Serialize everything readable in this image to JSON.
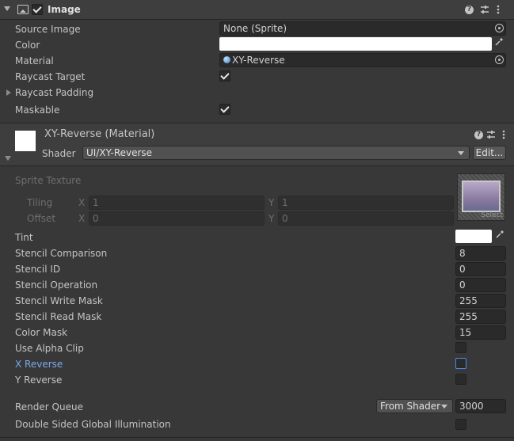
{
  "component": {
    "title": "Image",
    "enabled": true
  },
  "image_props": {
    "source_image_label": "Source Image",
    "source_image_value": "None (Sprite)",
    "color_label": "Color",
    "material_label": "Material",
    "material_value": "XY-Reverse",
    "raycast_target_label": "Raycast Target",
    "raycast_target_checked": true,
    "raycast_padding_label": "Raycast Padding",
    "maskable_label": "Maskable",
    "maskable_checked": true
  },
  "material": {
    "title": "XY-Reverse (Material)",
    "shader_label": "Shader",
    "shader_value": "UI/XY-Reverse",
    "edit_button": "Edit...",
    "sprite_texture_label": "Sprite Texture",
    "tiling_label": "Tiling",
    "offset_label": "Offset",
    "x_label": "X",
    "y_label": "Y",
    "tiling_x": "1",
    "tiling_y": "1",
    "offset_x": "0",
    "offset_y": "0",
    "select_label": "Select",
    "tint_label": "Tint",
    "stencil_comparison_label": "Stencil Comparison",
    "stencil_comparison_value": "8",
    "stencil_id_label": "Stencil ID",
    "stencil_id_value": "0",
    "stencil_operation_label": "Stencil Operation",
    "stencil_operation_value": "0",
    "stencil_write_mask_label": "Stencil Write Mask",
    "stencil_write_mask_value": "255",
    "stencil_read_mask_label": "Stencil Read Mask",
    "stencil_read_mask_value": "255",
    "color_mask_label": "Color Mask",
    "color_mask_value": "15",
    "use_alpha_clip_label": "Use Alpha Clip",
    "x_reverse_label": "X Reverse",
    "y_reverse_label": "Y Reverse",
    "render_queue_label": "Render Queue",
    "render_queue_mode": "From Shader",
    "render_queue_value": "3000",
    "double_sided_gi_label": "Double Sided Global Illumination"
  },
  "icons": {
    "collapse": "triangle-down-icon",
    "image_component": "image-component-icon",
    "help": "help-icon",
    "presets": "sliders-icon",
    "menu": "kebab-menu-icon",
    "object_picker": "object-picker-icon",
    "eyedropper": "eyedropper-icon"
  },
  "colors": {
    "background": "#383838",
    "header": "#3e3e3e",
    "field": "#2a2a2a",
    "focus": "#4a8ce6",
    "highlight_label": "#7aa9ee"
  }
}
